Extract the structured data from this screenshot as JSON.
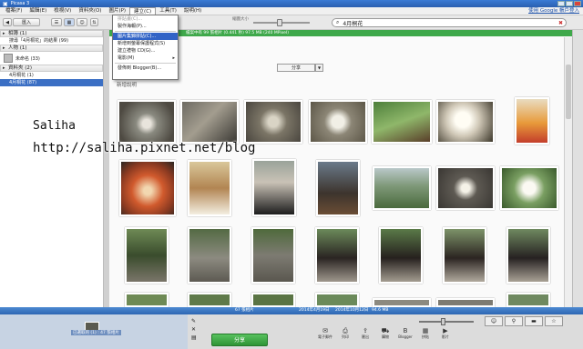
{
  "window": {
    "title": "Picasa 3"
  },
  "menu": {
    "items": [
      "檔案(F)",
      "編輯(E)",
      "檢視(V)",
      "資料夾(O)",
      "圖片(P)",
      "建立(C)",
      "工具(T)",
      "說明(H)"
    ],
    "google_link": "使用 Google 帳戶登入"
  },
  "toolbar": {
    "import_label": "匯入",
    "search_value": "4月桐花",
    "zoom_label": "縮圖大小"
  },
  "create_menu": {
    "items": [
      {
        "label": "拼貼畫(C)...",
        "state": "disabled"
      },
      {
        "label": "製作海報(P)...",
        "state": "normal"
      },
      {
        "label": "圖片集錦拼貼(C)...",
        "state": "highlighted"
      },
      {
        "label": "新增到螢幕保護程式(S)",
        "state": "normal"
      },
      {
        "label": "建立禮物 CD(G)...",
        "state": "normal"
      },
      {
        "label": "電影(M)",
        "state": "normal",
        "submenu": "▸"
      },
      {
        "label": "發佈到 Blogger(B)...",
        "state": "normal"
      }
    ]
  },
  "sidebar": {
    "groups": [
      {
        "title": "相簿 (1)",
        "rows": [
          {
            "label": "搜尋「4月桐花」的結果 (99)",
            "selected": false
          }
        ]
      },
      {
        "title": "人物 (1)",
        "people": [
          {
            "label": "未命名 (33)"
          }
        ]
      },
      {
        "title": "資料夾 (2)",
        "rows": [
          {
            "label": "4月桐花 (1)",
            "selected": false
          },
          {
            "label": "4月桐花 (87)",
            "selected": true
          }
        ]
      }
    ]
  },
  "content": {
    "status_text": "檔案中有 99 張相片 (0.441 秒) 97.5 MB (240 MPixel)",
    "share_label": "分享",
    "share_dropdown": "▼",
    "date_heading": "新增說明"
  },
  "watermark": {
    "name": "Saliha",
    "url": "http://saliha.pixnet.net/blog"
  },
  "bottom": {
    "stat1": "67 張相片",
    "stat2": "2014年4月19日",
    "stat3": "2014年10月12日",
    "stat4": "94.6 MB",
    "tray_label": "已選取的 (1) : 47 張相片",
    "upload_label": "分享",
    "actions": [
      {
        "label": "電子郵件",
        "icon": "✉"
      },
      {
        "label": "列印",
        "icon": "⎙"
      },
      {
        "label": "匯出",
        "icon": "⇪"
      },
      {
        "label": "購物",
        "icon": "⛟"
      },
      {
        "label": "Blogger",
        "icon": "B"
      },
      {
        "label": "拼貼",
        "icon": "▦"
      },
      {
        "label": "影片",
        "icon": "▶"
      }
    ],
    "right_icons": [
      "person-icon",
      "pin-icon",
      "folder-icon",
      "star-icon"
    ]
  },
  "colors": {
    "green": "#3ea84a",
    "blue": "#3163c6"
  }
}
